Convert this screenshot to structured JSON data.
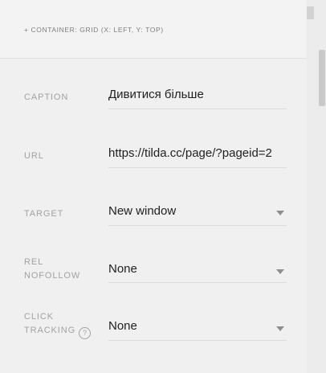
{
  "container": {
    "label": "+ CONTAINER: GRID (X: LEFT, Y: TOP)"
  },
  "fields": {
    "caption": {
      "label": "CAPTION",
      "value": "Дивитися більше"
    },
    "url": {
      "label": "URL",
      "value": "https://tilda.cc/page/?pageid=2"
    },
    "target": {
      "label": "TARGET",
      "value": "New window",
      "icon": "chevron-down-icon"
    },
    "rel_nofollow": {
      "label_line1": "REL",
      "label_line2": "NOFOLLOW",
      "value": "None",
      "icon": "chevron-down-icon"
    },
    "click_tracking": {
      "label_line1": "CLICK",
      "label_line2": "TRACKING",
      "help": "?",
      "value": "None",
      "icon": "chevron-down-icon"
    }
  }
}
